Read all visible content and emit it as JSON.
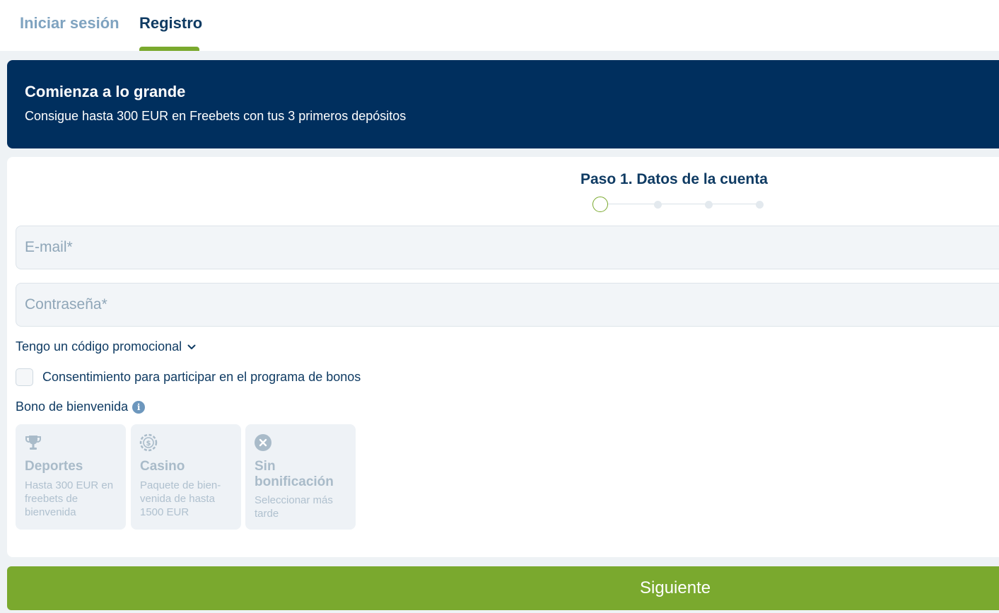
{
  "tabs": {
    "login": "Iniciar sesión",
    "register": "Registro"
  },
  "banner": {
    "title": "Comienza a lo grande",
    "subtitle": "Consigue hasta 300 EUR en Freebets con tus 3 primeros depósitos"
  },
  "step": {
    "title": "Paso 1. Datos de la cuenta",
    "current": 1,
    "total": 4
  },
  "form": {
    "email_placeholder": "E-mail*",
    "email_value": "",
    "password_placeholder": "Contraseña*",
    "password_value": "",
    "promo_label": "Tengo un código promocional",
    "consent_label": "Consentimiento para participar en el programa de bonos",
    "consent_checked": false,
    "bonus_label": "Bono de bienvenida"
  },
  "bonus_options": [
    {
      "title": "Deportes",
      "description": "Hasta 300 EUR en freebets de bienvenida",
      "icon": "trophy-icon"
    },
    {
      "title": "Casino",
      "description": "Paquete de bien-venida de hasta 1500 EUR",
      "icon": "casino-chip-icon"
    },
    {
      "title": "Sin bonificación",
      "description": "Seleccionar más tarde",
      "icon": "close-circle-icon"
    }
  ],
  "next_button": "Siguiente",
  "colors": {
    "primary": "#002f5e",
    "accent": "#7aa92e",
    "text": "#0f3b63",
    "muted": "#7fa3c0"
  }
}
